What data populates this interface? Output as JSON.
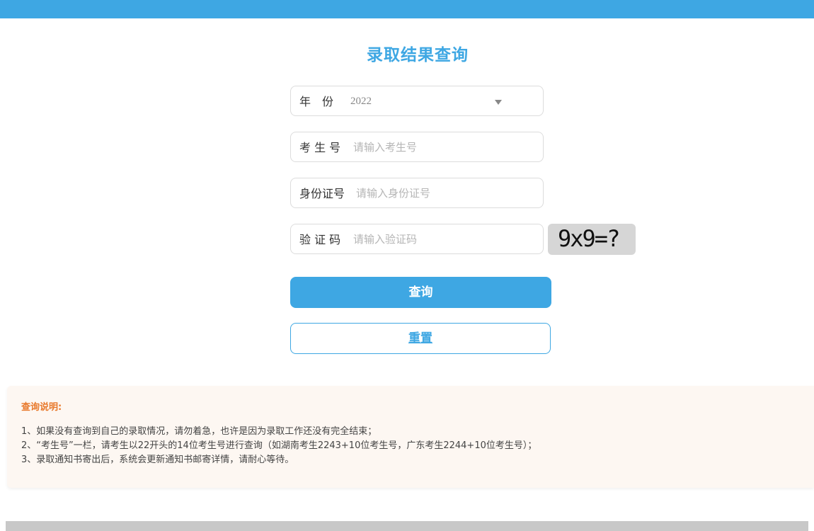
{
  "page": {
    "title": "录取结果查询"
  },
  "form": {
    "year": {
      "label": "年　份",
      "value": "2022"
    },
    "exam_number": {
      "label": "考 生 号",
      "placeholder": "请输入考生号"
    },
    "id_number": {
      "label": "身份证号",
      "placeholder": "请输入身份证号"
    },
    "captcha": {
      "label": "验 证 码",
      "placeholder": "请输入验证码",
      "image_text": "9x9=?"
    }
  },
  "buttons": {
    "query": "查询",
    "reset": "重置"
  },
  "notes": {
    "heading": "查询说明:",
    "lines": [
      "1、如果没有查询到自己的录取情况，请勿着急，也许是因为录取工作还没有完全结束；",
      "2、“考生号”一栏，请考生以22开头的14位考生号进行查询（如湖南考生2243+10位考生号，广东考生2244+10位考生号）；",
      "3、录取通知书寄出后，系统会更新通知书邮寄详情，请耐心等待。"
    ]
  },
  "colors": {
    "accent": "#3ea7e3",
    "notes_heading": "#e8792c",
    "notes_background": "#fdf7f2"
  }
}
